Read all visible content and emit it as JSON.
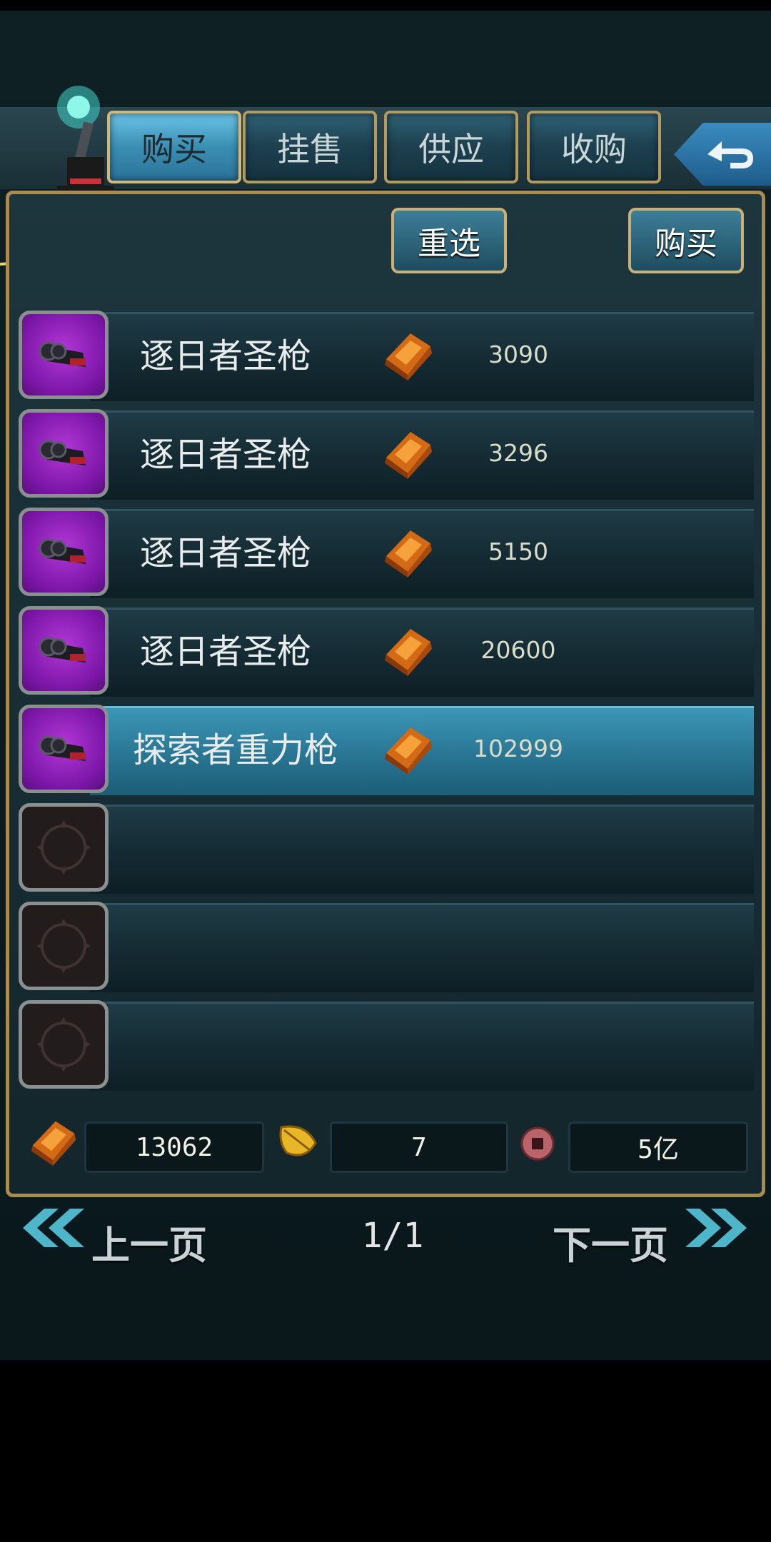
{
  "tabs": [
    {
      "label": "购买",
      "active": true
    },
    {
      "label": "挂售",
      "active": false
    },
    {
      "label": "供应",
      "active": false
    },
    {
      "label": "收购",
      "active": false
    }
  ],
  "actions": {
    "reselect_label": "重选",
    "buy_label": "购买"
  },
  "listings": [
    {
      "name": "逐日者圣枪",
      "price": "3090"
    },
    {
      "name": "逐日者圣枪",
      "price": "3296"
    },
    {
      "name": "逐日者圣枪",
      "price": "5150"
    },
    {
      "name": "逐日者圣枪",
      "price": "20600"
    },
    {
      "name": "探索者重力枪",
      "price": "102999",
      "selected": true
    }
  ],
  "currency": {
    "gold": "13062",
    "leaf": "7",
    "coin": "5亿"
  },
  "pager": {
    "prev_label": "上一页",
    "next_label": "下一页",
    "page": "1/1"
  },
  "colors": {
    "tab_active": "#4aa8cf",
    "row_selected": "#2a7896",
    "frame_gold": "#a88c52",
    "item_slot_purple": "#8a1cb8"
  }
}
